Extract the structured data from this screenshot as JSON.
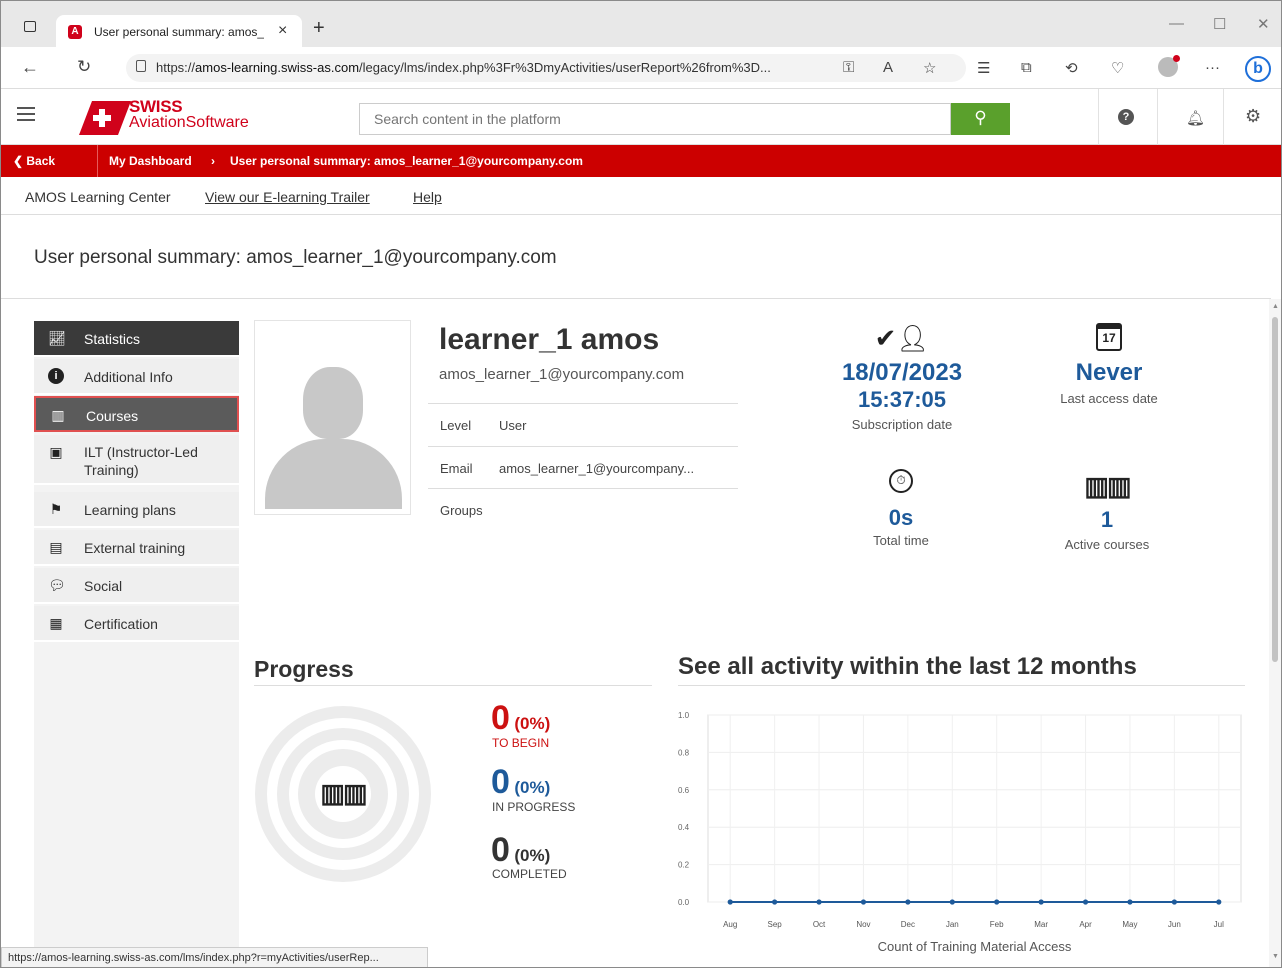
{
  "browser": {
    "tab_title": "User personal summary: amos_le",
    "url_prefix": "https://",
    "url_host": "amos-learning.swiss-as.com",
    "url_path": "/legacy/lms/index.php%3Fr%3DmyActivities/userReport%26from%3D...",
    "status_url": "https://amos-learning.swiss-as.com/lms/index.php?r=myActivities/userRep..."
  },
  "header": {
    "logo_line1": "SWISS",
    "logo_line2": "AviationSoftware",
    "search_placeholder": "Search content in the platform"
  },
  "breadcrumb": {
    "back": "Back",
    "dashboard": "My Dashboard",
    "current": "User personal summary: amos_learner_1@yourcompany.com"
  },
  "subnav": {
    "home": "AMOS Learning Center",
    "trailer": "View our E-learning Trailer",
    "help": "Help"
  },
  "page_title": "User personal summary: amos_learner_1@yourcompany.com",
  "sidebar": {
    "items": [
      {
        "label": "Statistics",
        "icon": "chart-icon"
      },
      {
        "label": "Additional Info",
        "icon": "info-icon"
      },
      {
        "label": "Courses",
        "icon": "books-icon"
      },
      {
        "label": "ILT (Instructor-Led Training)",
        "icon": "presentation-icon"
      },
      {
        "label": "Learning plans",
        "icon": "signpost-icon"
      },
      {
        "label": "External training",
        "icon": "clipboard-icon"
      },
      {
        "label": "Social",
        "icon": "chat-icon"
      },
      {
        "label": "Certification",
        "icon": "certificate-icon"
      }
    ]
  },
  "profile": {
    "name": "learner_1 amos",
    "email": "amos_learner_1@yourcompany.com",
    "level_label": "Level",
    "level_value": "User",
    "email_label": "Email",
    "email_value": "amos_learner_1@yourcompany...",
    "groups_label": "Groups"
  },
  "stats": {
    "subscription_date": "18/07/2023",
    "subscription_time": "15:37:05",
    "subscription_caption": "Subscription date",
    "last_access": "Never",
    "last_access_caption": "Last access date",
    "calendar_day": "17",
    "total_time": "0s",
    "total_time_caption": "Total time",
    "active_courses": "1",
    "active_courses_caption": "Active courses"
  },
  "progress": {
    "title": "Progress",
    "to_begin_num": "0",
    "to_begin_pct": "(0%)",
    "to_begin_label": "TO BEGIN",
    "in_progress_num": "0",
    "in_progress_pct": "(0%)",
    "in_progress_label": "IN PROGRESS",
    "completed_num": "0",
    "completed_pct": "(0%)",
    "completed_label": "COMPLETED"
  },
  "activity": {
    "title": "See all activity within the last 12 months"
  },
  "colors": {
    "brand_red": "#cc0000",
    "accent_blue": "#1e5a9a",
    "search_green": "#5aa02c",
    "to_begin_red": "#cc1111"
  },
  "chart_data": {
    "type": "line",
    "categories": [
      "Aug",
      "Sep",
      "Oct",
      "Nov",
      "Dec",
      "Jan",
      "Feb",
      "Mar",
      "Apr",
      "May",
      "Jun",
      "Jul"
    ],
    "series": [
      {
        "values": [
          0,
          0,
          0,
          0,
          0,
          0,
          0,
          0,
          0,
          0,
          0,
          0
        ]
      }
    ],
    "yticks": [
      "0.0",
      "0.2",
      "0.4",
      "0.6",
      "0.8",
      "1.0"
    ],
    "ylim": [
      0,
      1
    ],
    "xlabel": "Count of Training Material Access",
    "grid": true
  }
}
